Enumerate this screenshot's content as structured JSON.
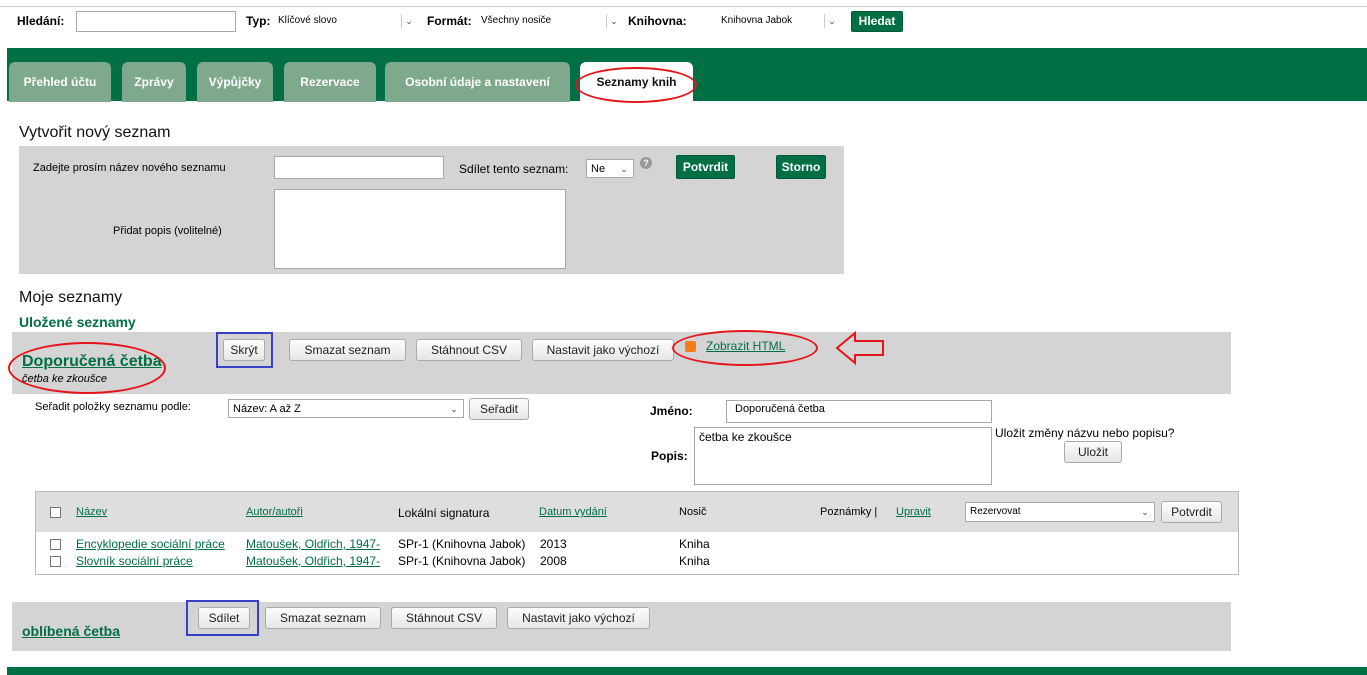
{
  "search": {
    "label": "Hledání:",
    "value": "",
    "type_label": "Typ:",
    "type_value": "Klíčové slovo",
    "format_label": "Formát:",
    "format_value": "Všechny nosiče",
    "library_label": "Knihovna:",
    "library_value": "Knihovna Jabok",
    "submit": "Hledat"
  },
  "tabs": [
    "Přehled účtu",
    "Zprávy",
    "Výpůjčky",
    "Rezervace",
    "Osobní údaje a nastavení",
    "Seznamy knih"
  ],
  "create": {
    "title": "Vytvořit nový seznam",
    "name_label": "Zadejte prosím název nového seznamu",
    "name_value": "",
    "share_label": "Sdílet tento seznam:",
    "share_value": "Ne",
    "confirm": "Potvrdit",
    "cancel": "Storno",
    "desc_label": "Přidat popis (volitelné)",
    "desc_value": ""
  },
  "my_lists": {
    "title": "Moje seznamy",
    "saved_title": "Uložené seznamy"
  },
  "list1": {
    "name": "Doporučená četba",
    "description": "četba ke zkoušce",
    "btn_hide": "Skrýt",
    "btn_delete": "Smazat seznam",
    "btn_csv": "Stáhnout CSV",
    "btn_default": "Nastavit jako výchozí",
    "html_link": "Zobrazit HTML",
    "sort_label": "Seřadit položky seznamu podle:",
    "sort_value": "Název: A až Z",
    "sort_btn": "Seřadit",
    "name_label": "Jméno:",
    "name_value": "Doporučená četba",
    "desc_label": "Popis:",
    "desc_value": "četba ke zkoušce",
    "save_prompt": "Uložit změny názvu nebo popisu?",
    "save_btn": "Uložit",
    "table": {
      "headers": {
        "title": "Název",
        "author": "Autor/autoři",
        "callno": "Lokální signatura",
        "date": "Datum vydání",
        "format": "Nosič",
        "notes": "Poznámky |",
        "edit": "Upravit"
      },
      "action_value": "Rezervovat",
      "action_btn": "Potvrdit",
      "rows": [
        {
          "title": "Encyklopedie sociální práce",
          "author": "Matoušek, Oldřich, 1947-",
          "callno": "SPr-1 (Knihovna Jabok)",
          "date": "2013",
          "format": "Kniha"
        },
        {
          "title": "Slovník sociální práce",
          "author": "Matoušek, Oldřich, 1947-",
          "callno": "SPr-1 (Knihovna Jabok)",
          "date": "2008",
          "format": "Kniha"
        }
      ]
    }
  },
  "list2": {
    "name": "oblíbená četba",
    "btn_share": "Sdílet",
    "btn_delete": "Smazat seznam",
    "btn_csv": "Stáhnout CSV",
    "btn_default": "Nastavit jako výchozí"
  },
  "colors": {
    "brand_green": "#006f44",
    "tab_inactive": "#7fa98c",
    "annotation_red": "#e4141b",
    "annotation_blue": "#3a3fc9"
  }
}
